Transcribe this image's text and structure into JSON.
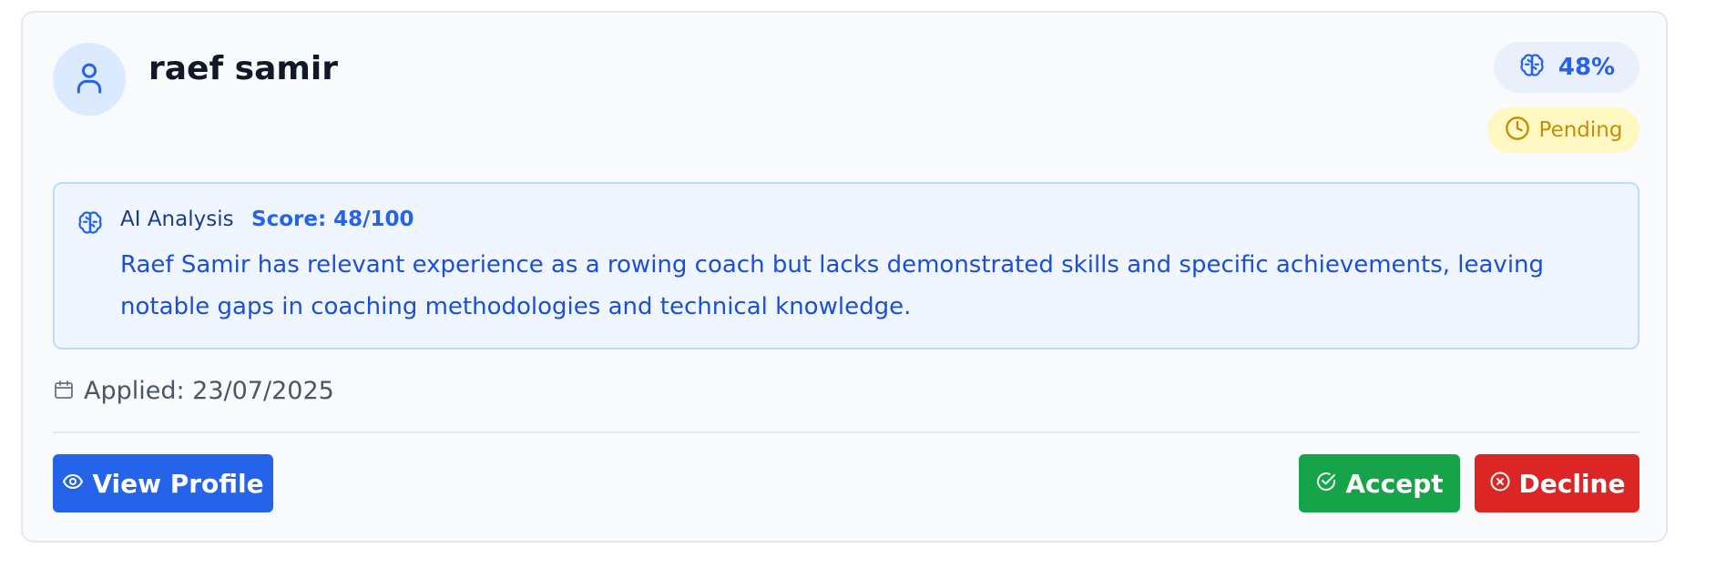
{
  "candidate": {
    "name": "raef samir",
    "avatar_icon": "user-icon",
    "match_percent": "48%",
    "status": "Pending"
  },
  "analysis": {
    "label": "AI Analysis",
    "score": "Score: 48/100",
    "summary": "Raef Samir has relevant experience as a rowing coach but lacks demonstrated skills and specific achievements, leaving notable gaps in coaching methodologies and technical knowledge."
  },
  "meta": {
    "applied": "Applied: 23/07/2025"
  },
  "actions": {
    "view_label": "View Profile",
    "accept_label": "Accept",
    "decline_label": "Decline"
  },
  "colors": {
    "primary": "#2563eb",
    "success": "#16a34a",
    "danger": "#dc2626",
    "pending": "#ca8a04"
  },
  "icons": {
    "match": "brain-icon",
    "status": "clock-icon",
    "analysis": "brain-icon",
    "applied": "calendar-icon",
    "view": "eye-icon",
    "accept": "check-circle-icon",
    "decline": "x-circle-icon"
  }
}
